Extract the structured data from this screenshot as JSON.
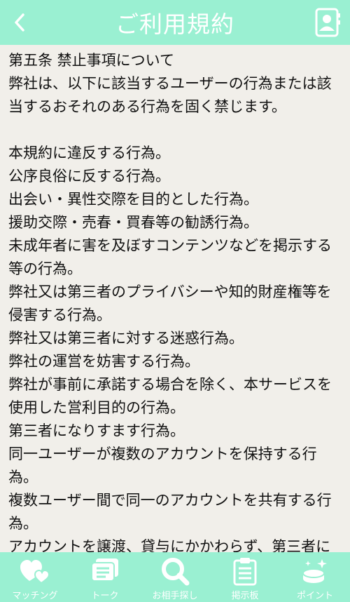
{
  "header": {
    "title": "ご利用規約",
    "back_icon": "chevron-left-icon",
    "profile_icon": "profile-card-icon"
  },
  "content": {
    "heading": "第五条 禁止事項について",
    "intro": "弊社は、以下に該当するユーザーの行為または該当するおそれのある行為を固く禁じます。",
    "items": [
      "本規約に違反する行為。",
      "公序良俗に反する行為。",
      "出会い・異性交際を目的とした行為。",
      "援助交際・売春・買春等の勧誘行為。",
      "未成年者に害を及ぼすコンテンツなどを掲示する等の行為。",
      "弊社又は第三者のプライバシーや知的財産権等を侵害する行為。",
      "弊社又は第三者に対する迷惑行為。",
      "弊社の運営を妨害する行為。",
      "弊社が事前に承諾する場合を除く、本サービスを使用した営利目的の行為。",
      "第三者になりすます行為。",
      "同一ユーザーが複数のアカウントを保持する行為。",
      "複数ユーザー間で同一のアカウントを共有する行為。",
      "アカウントを譲渡、貸与にかかわらず、第三者に"
    ]
  },
  "tabbar": {
    "tabs": [
      {
        "label": "マッチング",
        "icon": "hearts-icon"
      },
      {
        "label": "トーク",
        "icon": "chat-bubble-icon"
      },
      {
        "label": "お相手探し",
        "icon": "search-icon"
      },
      {
        "label": "掲示板",
        "icon": "clipboard-icon"
      },
      {
        "label": "ポイント",
        "icon": "coins-icon"
      }
    ]
  },
  "colors": {
    "accent": "#9af0d2",
    "background": "#f1efea",
    "text": "#111111"
  }
}
